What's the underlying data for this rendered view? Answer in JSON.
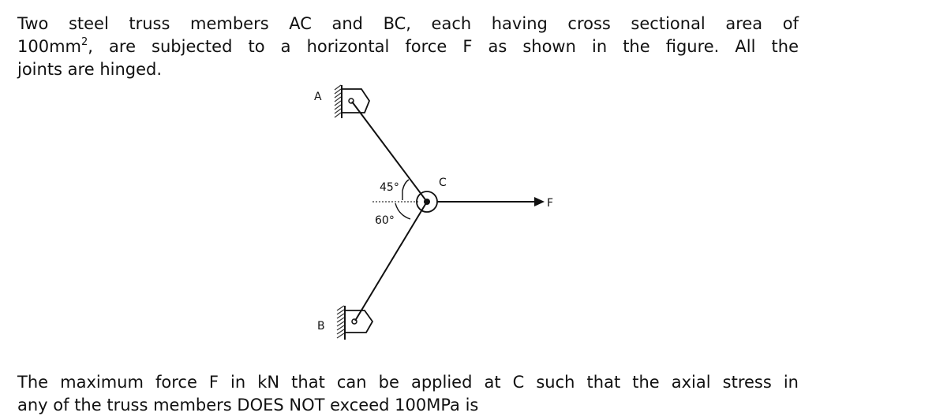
{
  "question": {
    "intro_lines": [
      "Two steel truss members AC and BC, each having cross sectional area of",
      "100mm",
      ", are subjected to a horizontal force F as shown in the figure. All the",
      "joints are hinged."
    ],
    "intro_superscript": "2",
    "prompt_lines": [
      "The maximum force F in kN that can be applied at C such that the axial stress in",
      "any of the truss members DOES NOT exceed 100MPa is"
    ]
  },
  "figure": {
    "labels": {
      "support_a": "A",
      "support_b": "B",
      "joint_c": "C",
      "force": "F",
      "angle_upper": "45°",
      "angle_lower": "60°"
    },
    "angles_deg": {
      "AC_from_horizontal": 45,
      "BC_from_horizontal": 60
    },
    "members": [
      "AC",
      "BC"
    ],
    "cross_sectional_area": "100mm²",
    "support_type": "hinged"
  }
}
